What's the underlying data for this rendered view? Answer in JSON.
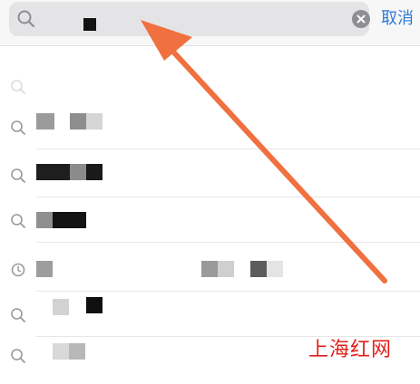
{
  "search": {
    "placeholder": "",
    "value": "",
    "cancel_label": "取消"
  },
  "suggestions": [
    {
      "label": ""
    },
    {
      "label": ""
    },
    {
      "label": ""
    },
    {
      "label": ""
    },
    {
      "label": ""
    },
    {
      "label": ""
    },
    {
      "label": ""
    }
  ],
  "watermark": "上海红网",
  "colors": {
    "accent": "#2f7bd7",
    "arrow": "#f0703f",
    "watermark": "#e0201b"
  }
}
